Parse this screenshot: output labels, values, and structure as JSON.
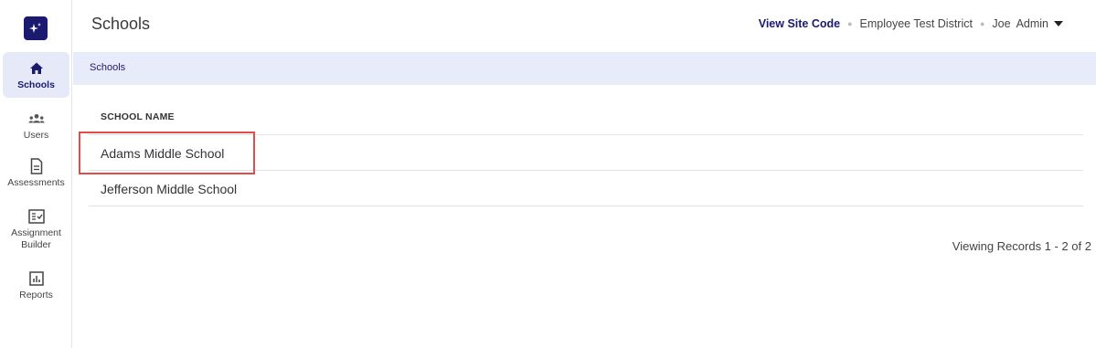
{
  "header": {
    "title": "Schools",
    "site_code_label": "View Site Code",
    "district": "Employee Test District",
    "user_first": "Joe",
    "user_role": "Admin"
  },
  "sidebar": {
    "items": [
      {
        "label": "Schools",
        "icon": "home-icon"
      },
      {
        "label": "Users",
        "icon": "users-icon"
      },
      {
        "label": "Assessments",
        "icon": "document-icon"
      },
      {
        "label": "Assignment Builder",
        "icon": "checklist-icon"
      },
      {
        "label": "Reports",
        "icon": "bar-chart-icon"
      }
    ]
  },
  "breadcrumb": {
    "current": "Schools"
  },
  "table": {
    "column_header": "SCHOOL NAME",
    "rows": [
      "Adams Middle School",
      "Jefferson Middle School"
    ]
  },
  "pagination": {
    "text": "Viewing Records 1 - 2 of 2"
  },
  "colors": {
    "brand": "#1a1a6e",
    "breadcrumb_bg": "#e8ecfa",
    "highlight": "#e24c4c"
  }
}
